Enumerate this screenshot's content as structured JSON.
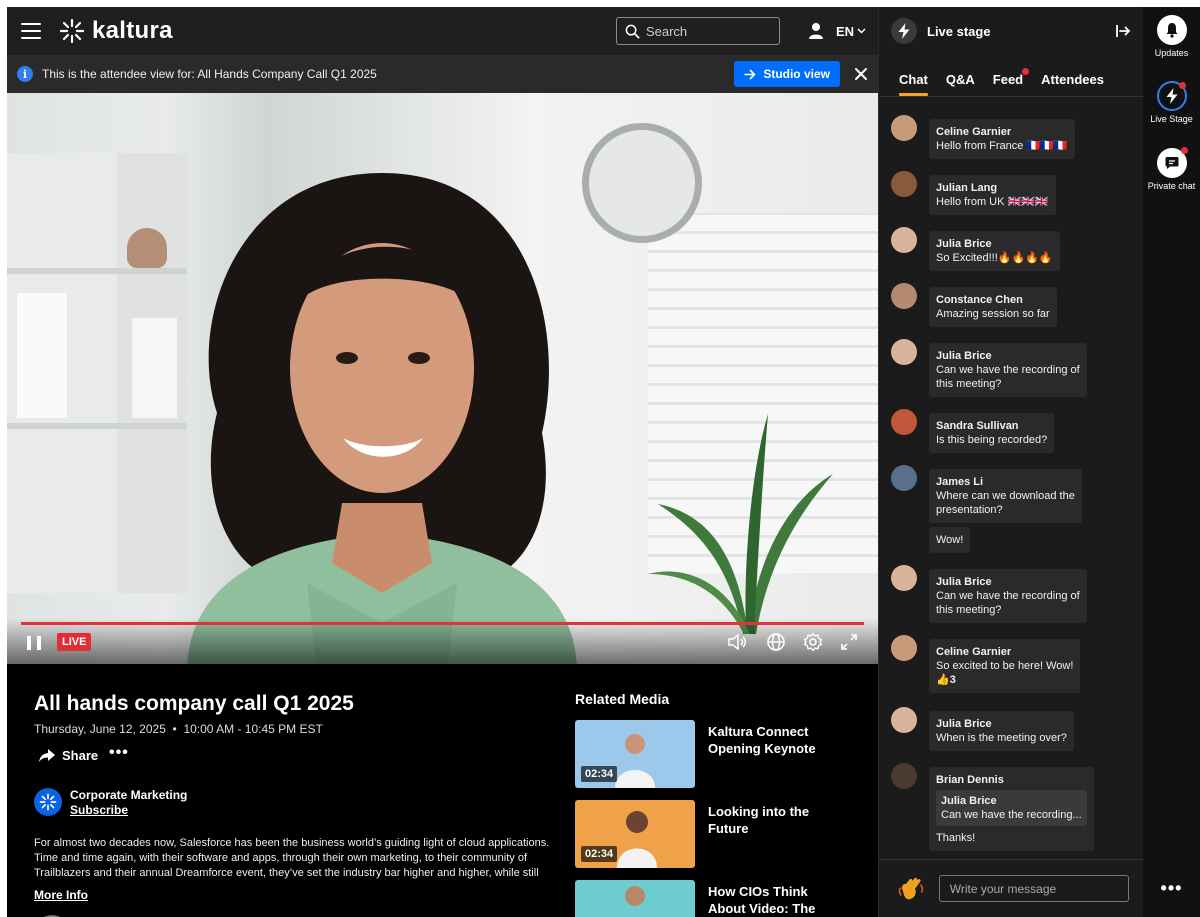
{
  "header": {
    "logo_text": "kaltura",
    "search_placeholder": "Search",
    "language": "EN"
  },
  "info_bar": {
    "text": "This is the attendee view for: All Hands Company Call Q1 2025",
    "studio_button": "Studio view"
  },
  "player": {
    "live_badge": "LIVE"
  },
  "event": {
    "title": "All hands company call Q1 2025",
    "date": "Thursday, June 12, 2025",
    "time": "10:00 AM - 10:45 PM EST",
    "share_label": "Share",
    "more_label": "•••",
    "channel_name": "Corporate Marketing",
    "subscribe_label": "Subscribe",
    "description": "For almost two decades now, Salesforce has been the business world’s guiding light of cloud applications. Time and time again, with their software and apps, through their own marketing, to their community of Trailblazers and their annual Dreamforce event, they’ve set the industry bar higher and higher, while still",
    "more_info_label": "More Info"
  },
  "related": {
    "title": "Related Media",
    "items": [
      {
        "title": "Kaltura Connect Opening Keynote",
        "duration": "02:34",
        "color": "#9cc8ec"
      },
      {
        "title": "Looking into the Future",
        "duration": "02:34",
        "color": "#f0a24a"
      },
      {
        "title": "How CIOs Think About Video: The Oracle Story",
        "duration": "",
        "color": "#6ecbd0"
      }
    ]
  },
  "panel": {
    "title": "Live stage",
    "tabs": [
      "Chat",
      "Q&A",
      "Feed",
      "Attendees"
    ],
    "composer_placeholder": "Write your message",
    "messages": [
      {
        "name": "Celine Garnier",
        "text": "Hello from France 🇫🇷🇫🇷🇫🇷",
        "avatar": "#c89a78"
      },
      {
        "name": "Julian Lang",
        "text": "Hello from UK 🇬🇧🇬🇧🇬🇧",
        "avatar": "#8a5a3c"
      },
      {
        "name": "Julia Brice",
        "text": "So Excited!!!🔥🔥🔥🔥",
        "avatar": "#d7b49a"
      },
      {
        "name": "Constance Chen",
        "text": "Amazing session so far",
        "avatar": "#b58a6e"
      },
      {
        "name": "Julia Brice",
        "text": "Can we have the recording of",
        "text2": "this meeting?",
        "avatar": "#d7b49a"
      },
      {
        "name": "Sandra Sullivan",
        "text": "Is this being recorded?",
        "avatar": "#c0563a"
      },
      {
        "name": "James Li",
        "text": "Where can we download the",
        "text2": "presentation?",
        "extra": "Wow!",
        "avatar": "#5a6f8a"
      },
      {
        "name": "Julia Brice",
        "text": "Can we have the recording of",
        "text2": "this meeting?",
        "avatar": "#d7b49a"
      },
      {
        "name": "Celine Garnier",
        "text": "So excited to be here! Wow!",
        "reaction": "👍3",
        "avatar": "#c89a78"
      },
      {
        "name": "Julia Brice",
        "text": "When is the meeting over?",
        "avatar": "#d7b49a"
      },
      {
        "name": "Brian Dennis",
        "quote_name": "Julia Brice",
        "quote_text": "Can we have the recording...",
        "text": "Thanks!",
        "avatar": "#4a3a32"
      }
    ]
  },
  "rail": {
    "items": [
      "Updates",
      "Live Stage",
      "Private chat"
    ],
    "more_label": "•••"
  },
  "colors": {
    "accent_blue": "#006efa",
    "live_red": "#e12d36",
    "tab_underline": "#f5a623"
  }
}
